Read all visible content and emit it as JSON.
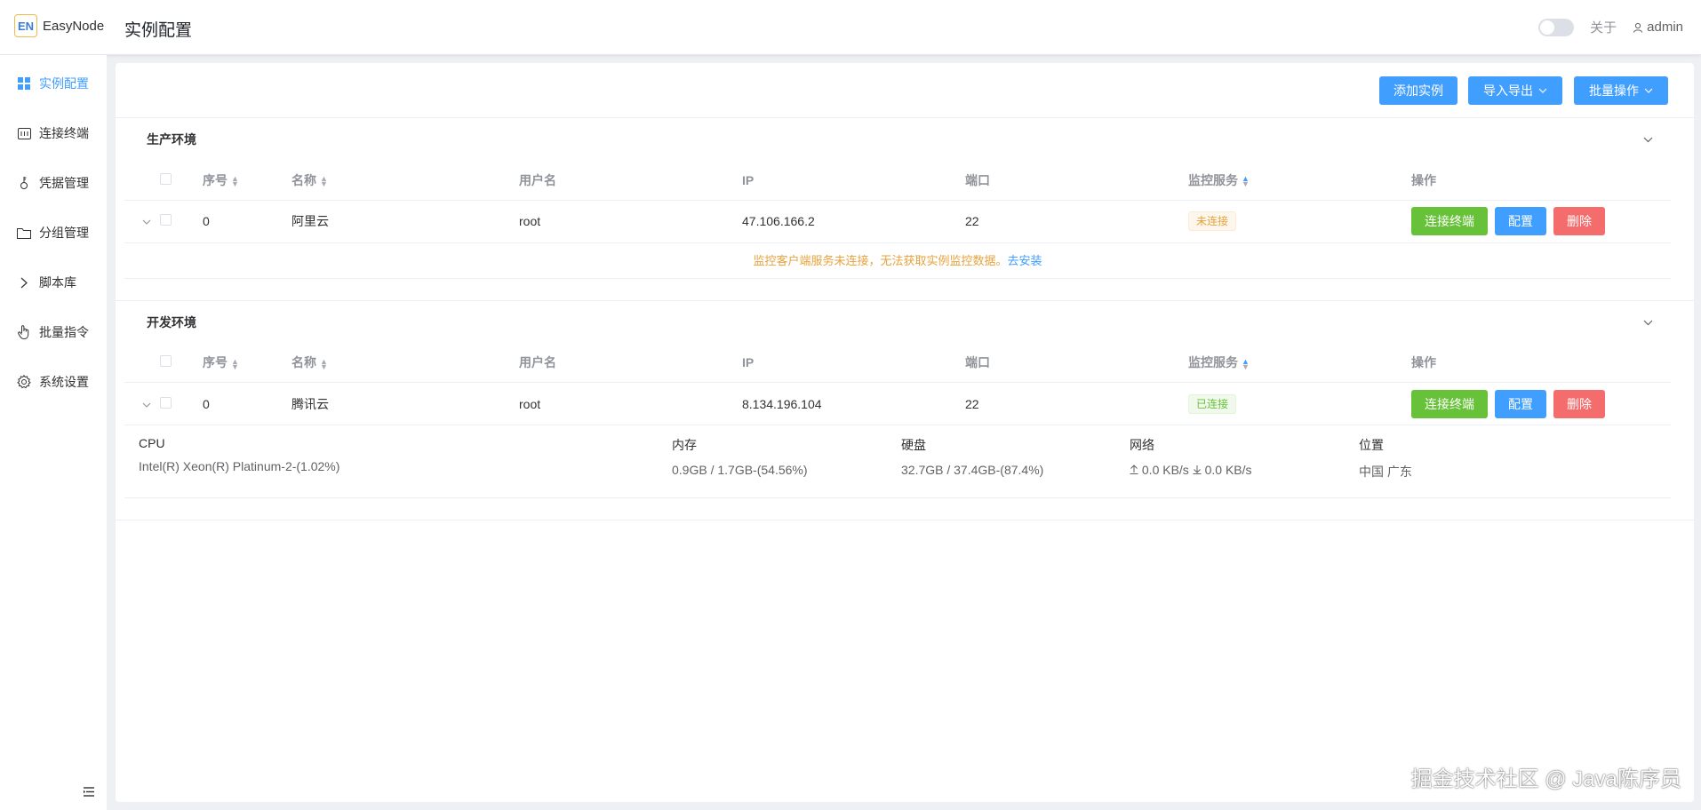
{
  "app": {
    "logo_mark": "EN",
    "name": "EasyNode"
  },
  "header": {
    "title": "实例配置",
    "about": "关于",
    "user": "admin"
  },
  "sidebar": {
    "items": [
      {
        "label": "实例配置",
        "icon": "grid-icon",
        "active": true
      },
      {
        "label": "连接终端",
        "icon": "terminal-icon",
        "active": false
      },
      {
        "label": "凭据管理",
        "icon": "key-icon",
        "active": false
      },
      {
        "label": "分组管理",
        "icon": "folder-icon",
        "active": false
      },
      {
        "label": "脚本库",
        "icon": "chevron-right-icon",
        "active": false
      },
      {
        "label": "批量指令",
        "icon": "pointer-icon",
        "active": false
      },
      {
        "label": "系统设置",
        "icon": "gear-icon",
        "active": false
      }
    ]
  },
  "toolbar": {
    "add": "添加实例",
    "import_export": "导入导出",
    "batch": "批量操作"
  },
  "table_headers": {
    "index": "序号",
    "name": "名称",
    "username": "用户名",
    "ip": "IP",
    "port": "端口",
    "monitor": "监控服务",
    "actions": "操作"
  },
  "groups": [
    {
      "title": "生产环境",
      "rows": [
        {
          "index": "0",
          "name": "阿里云",
          "username": "root",
          "ip": "47.106.166.2",
          "port": "22",
          "status": "未连接",
          "connected": false
        }
      ],
      "notice": "监控客户端服务未连接，无法获取实例监控数据。",
      "notice_link": "去安装"
    },
    {
      "title": "开发环境",
      "rows": [
        {
          "index": "0",
          "name": "腾讯云",
          "username": "root",
          "ip": "8.134.196.104",
          "port": "22",
          "status": "已连接",
          "connected": true
        }
      ],
      "metrics": {
        "cpu_label": "CPU",
        "cpu_value": "Intel(R) Xeon(R) Platinum-2-(1.02%)",
        "mem_label": "内存",
        "mem_value": "0.9GB / 1.7GB-(54.56%)",
        "disk_label": "硬盘",
        "disk_value": "32.7GB / 37.4GB-(87.4%)",
        "net_label": "网络",
        "net_up": "0.0 KB/s",
        "net_down": "0.0 KB/s",
        "loc_label": "位置",
        "loc_value": "中国 广东"
      }
    }
  ],
  "row_actions": {
    "connect": "连接终端",
    "config": "配置",
    "delete": "删除"
  },
  "watermark": "掘金技术社区 @ Java陈序员",
  "colors": {
    "primary": "#409eff",
    "success": "#67c23a",
    "danger": "#f56c6c",
    "warning": "#e6a23c"
  }
}
